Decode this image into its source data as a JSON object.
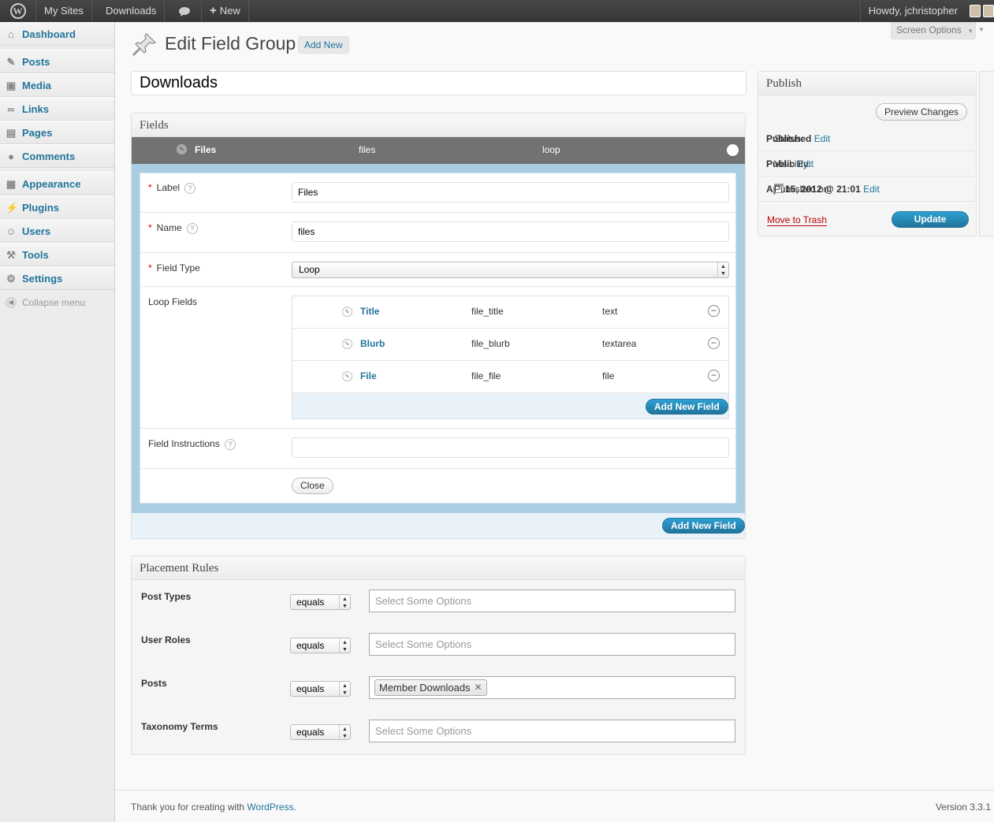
{
  "adminbar": {
    "my_sites": "My Sites",
    "site_name": "Downloads",
    "new": "New",
    "howdy": "Howdy, jchristopher"
  },
  "sidebar": {
    "items": [
      {
        "label": "Dashboard",
        "icon": "dashboard-icon"
      },
      {
        "label": "Posts",
        "icon": "pin-icon"
      },
      {
        "label": "Media",
        "icon": "media-icon"
      },
      {
        "label": "Links",
        "icon": "link-icon"
      },
      {
        "label": "Pages",
        "icon": "page-icon"
      },
      {
        "label": "Comments",
        "icon": "comment-icon"
      },
      {
        "label": "Appearance",
        "icon": "appearance-icon"
      },
      {
        "label": "Plugins",
        "icon": "plugin-icon"
      },
      {
        "label": "Users",
        "icon": "users-icon"
      },
      {
        "label": "Tools",
        "icon": "tools-icon"
      },
      {
        "label": "Settings",
        "icon": "settings-icon"
      }
    ],
    "collapse": "Collapse menu"
  },
  "header": {
    "screen_options": "Screen Options",
    "title": "Edit Field Group",
    "add_new": "Add New"
  },
  "post_title": "Downloads",
  "fields": {
    "heading": "Fields",
    "field": {
      "label": "Files",
      "name": "files",
      "type": "loop"
    },
    "editor": {
      "label_label": "Label",
      "label_value": "Files",
      "name_label": "Name",
      "name_value": "files",
      "type_label": "Field Type",
      "type_value": "Loop",
      "loop_label": "Loop Fields",
      "loop_fields": [
        {
          "label": "Title",
          "name": "file_title",
          "type": "text"
        },
        {
          "label": "Blurb",
          "name": "file_blurb",
          "type": "textarea"
        },
        {
          "label": "File",
          "name": "file_file",
          "type": "file"
        }
      ],
      "add_new_field": "Add New Field",
      "instructions_label": "Field Instructions",
      "instructions_value": "",
      "close": "Close"
    },
    "add_new_field": "Add New Field"
  },
  "placement": {
    "heading": "Placement Rules",
    "rules": [
      {
        "label": "Post Types",
        "operator": "equals",
        "placeholder": "Select Some Options"
      },
      {
        "label": "User Roles",
        "operator": "equals",
        "placeholder": "Select Some Options"
      },
      {
        "label": "Posts",
        "operator": "equals",
        "chip": "Member Downloads"
      },
      {
        "label": "Taxonomy Terms",
        "operator": "equals",
        "placeholder": "Select Some Options"
      }
    ]
  },
  "publish": {
    "heading": "Publish",
    "preview": "Preview Changes",
    "status_label": "Status:",
    "status_value": "Published",
    "visibility_label": "Visibility:",
    "visibility_value": "Public",
    "published_label": "Published on:",
    "published_value": "Apr 15, 2012 @ 21:01",
    "edit": "Edit",
    "trash": "Move to Trash",
    "update": "Update"
  },
  "footer": {
    "thanks": "Thank you for creating with ",
    "wordpress": "WordPress",
    "period": ".",
    "version": "Version 3.3.1"
  },
  "colors": {
    "link": "#21759b",
    "primary_button": "#21759b",
    "field_header": "#727272",
    "editor_border": "#abcde3",
    "trash": "#bb0000"
  }
}
